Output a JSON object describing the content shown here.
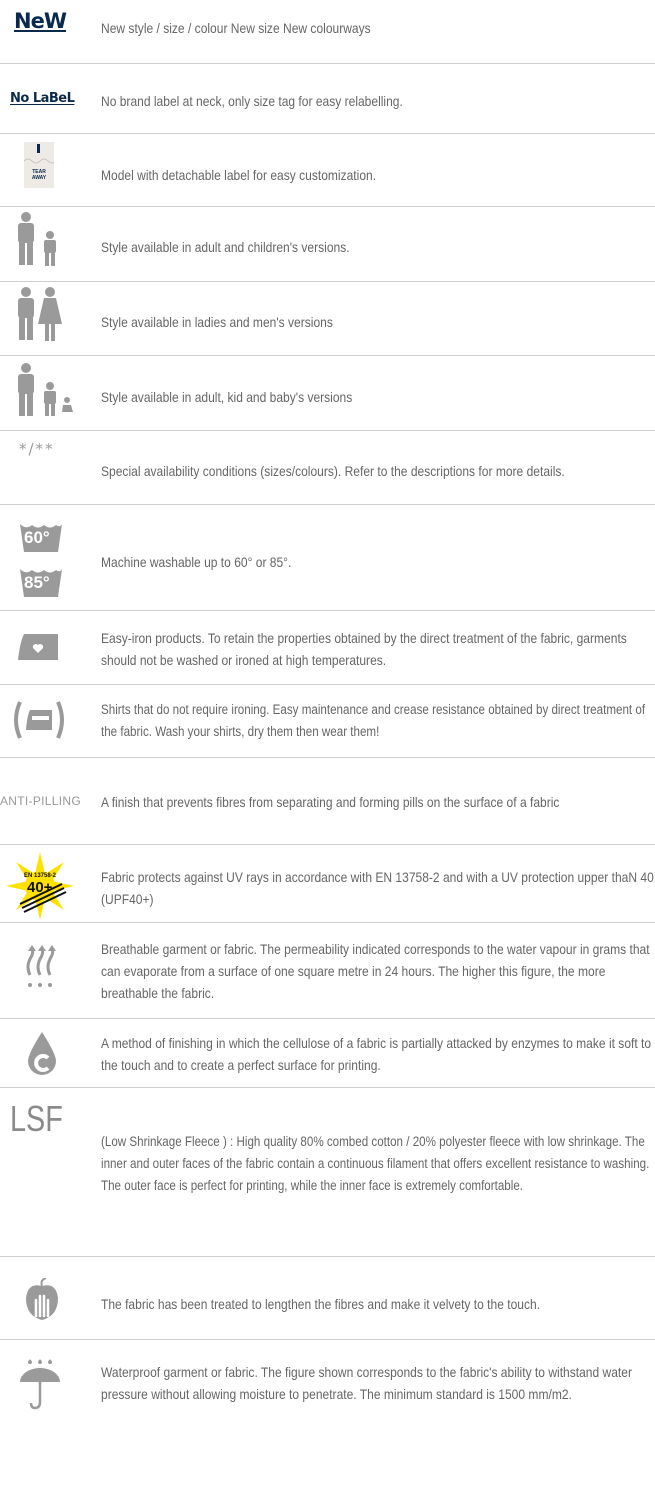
{
  "legend": {
    "new": {
      "badge": "NeW",
      "text": "New style / size / colour New size New colourways"
    },
    "no_label": {
      "badge": "No LaBeL",
      "text": "No brand label at neck, only size tag for easy relabelling."
    },
    "tear_away": {
      "badge_top": "TEAR",
      "badge_bottom": "AWAY",
      "text": "Model with detachable label for easy customization."
    },
    "adult_child": {
      "text": "Style available in adult and children's versions."
    },
    "ladies_men": {
      "text": "Style available in ladies and men's versions"
    },
    "adult_kid_baby": {
      "text": "Style available in adult, kid and baby's versions"
    },
    "special": {
      "badge": "*/**",
      "text": "Special availability conditions (sizes/colours). Refer to the descriptions for more details."
    },
    "washable": {
      "badge_60": "60°",
      "badge_85": "85°",
      "text": "Machine washable up to 60° or 85°."
    },
    "easy_iron": {
      "text": "Easy-iron products. To retain the properties obtained by the direct treatment of the fabric, garments should not be washed or ironed at high temperatures."
    },
    "no_iron": {
      "text": "Shirts that do not require ironing. Easy maintenance and crease resistance obtained by direct treatment of the fabric. Wash your shirts, dry them then wear them!"
    },
    "anti_pilling": {
      "badge": "ANTI-PILLING",
      "text": "A finish that prevents fibres from separating and forming pills on the surface of a fabric"
    },
    "uv": {
      "badge_top": "EN 13758-2",
      "badge_value": "40+",
      "text": "Fabric protects against UV rays in accordance with EN 13758-2 and with a UV protection upper thaN 40 (UPF40+)"
    },
    "breathable": {
      "text": "Breathable garment or fabric. The permeability indicated corresponds to the water vapour in grams that can evaporate from a surface of one square metre in 24 hours. The higher this figure, the more breathable the fabric."
    },
    "enzyme": {
      "text": "A method of finishing in which the cellulose of a fabric is partially attacked by enzymes to make it soft to the touch and to create a perfect surface for printing."
    },
    "lsf": {
      "badge": "LSF",
      "text": "(Low Shrinkage Fleece ) : High quality 80% combed cotton / 20% polyester fleece with low shrinkage. The inner and outer faces of the fabric contain a continuous filament that offers excellent resistance to washing. The outer face is perfect for printing, while the inner face is extremely comfortable."
    },
    "velvety": {
      "text": "The fabric has been treated to lengthen the fibres and make it velvety to the touch."
    },
    "waterproof": {
      "text": "Waterproof garment or fabric. The figure shown corresponds to the fabric's ability to withstand water pressure without allowing moisture to penetrate. The minimum standard is 1500 mm/m2."
    }
  },
  "colors": {
    "navy": "#0a2a4d",
    "icon_gray": "#9a9a9a",
    "text": "#666666",
    "rule": "#cfcfcf",
    "uv_yellow": "#ffe100"
  }
}
